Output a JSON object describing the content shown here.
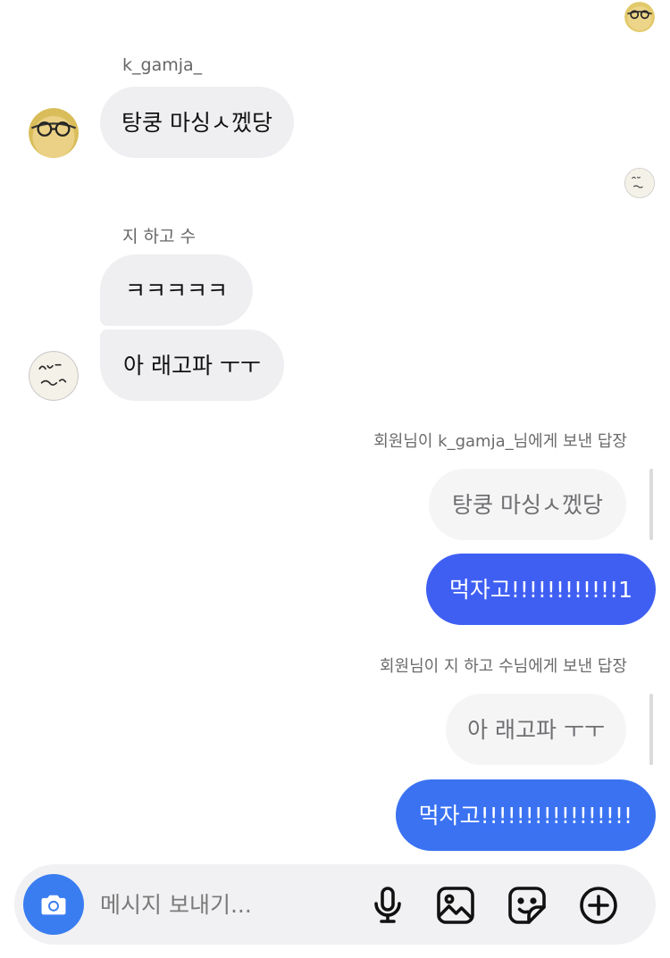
{
  "thread": {
    "msg1": {
      "sender": "k_gamja_",
      "text": "탕쿵 마싱ㅅ껬당"
    },
    "msg2": {
      "sender": "지 하고 수",
      "text1": "ㅋㅋㅋㅋㅋ",
      "text2": "아 래고파 ㅜㅜ"
    },
    "reply1": {
      "label": "회원님이 k_gamja_님에게 보낸 답장",
      "quote": "탕쿵 마싱ㅅ껬당",
      "text": "먹자고!!!!!!!!!!!!1"
    },
    "reply2": {
      "label": "회원님이 지 하고 수님에게 보낸 답장",
      "quote": "아 래고파 ㅜㅜ",
      "text": "먹자고!!!!!!!!!!!!!!!!!"
    }
  },
  "composer": {
    "placeholder": "메시지 보내기...",
    "icons": [
      "camera-icon",
      "microphone-icon",
      "image-icon",
      "sticker-icon",
      "add-icon"
    ]
  },
  "colors": {
    "outgoing_bubble_1": "#3f5ff3",
    "outgoing_bubble_2": "#3a72f2",
    "incoming_bubble": "#efeff1",
    "camera_button": "#3a7df1"
  }
}
